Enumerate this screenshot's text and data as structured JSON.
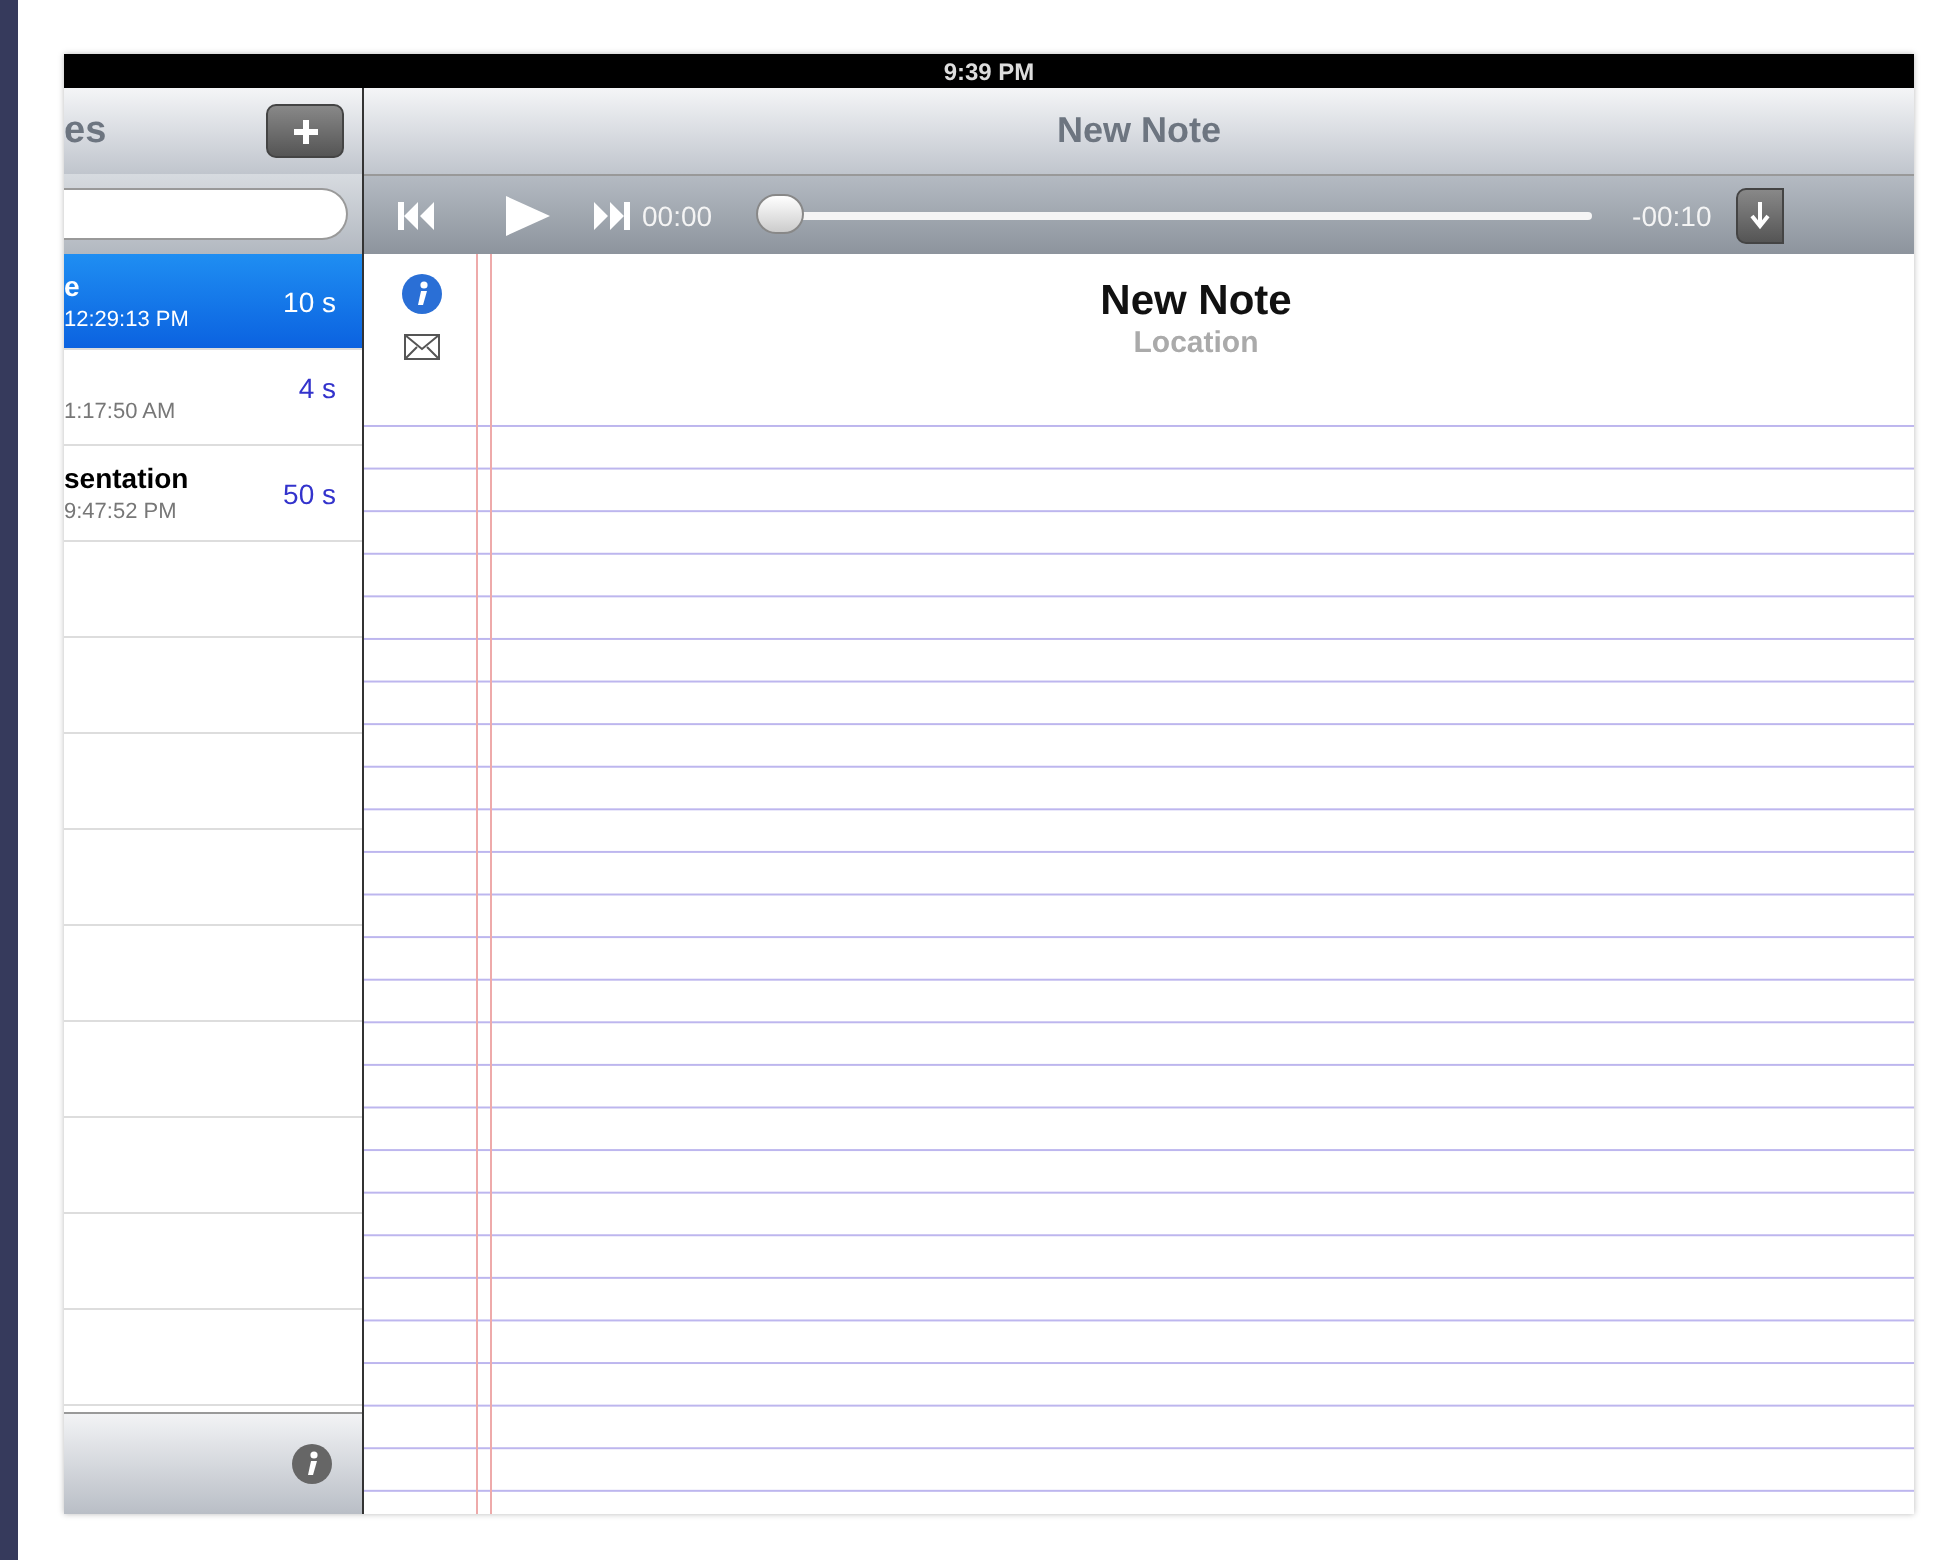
{
  "status_bar": {
    "time": "9:39 PM"
  },
  "sidebar": {
    "title": "es",
    "items": [
      {
        "title": "e",
        "date": "12:29:13 PM",
        "duration": "10 s",
        "selected": true
      },
      {
        "date": "1:17:50 AM",
        "duration": "4 s",
        "selected": false
      },
      {
        "title": "sentation",
        "date": "9:47:52 PM",
        "duration": "50 s",
        "selected": false
      }
    ]
  },
  "nav_bar": {
    "title": "New Note"
  },
  "player": {
    "elapsed": "00:00",
    "level": 0,
    "remaining": "-00:10"
  },
  "note": {
    "title": "New Note",
    "location": "Location"
  }
}
